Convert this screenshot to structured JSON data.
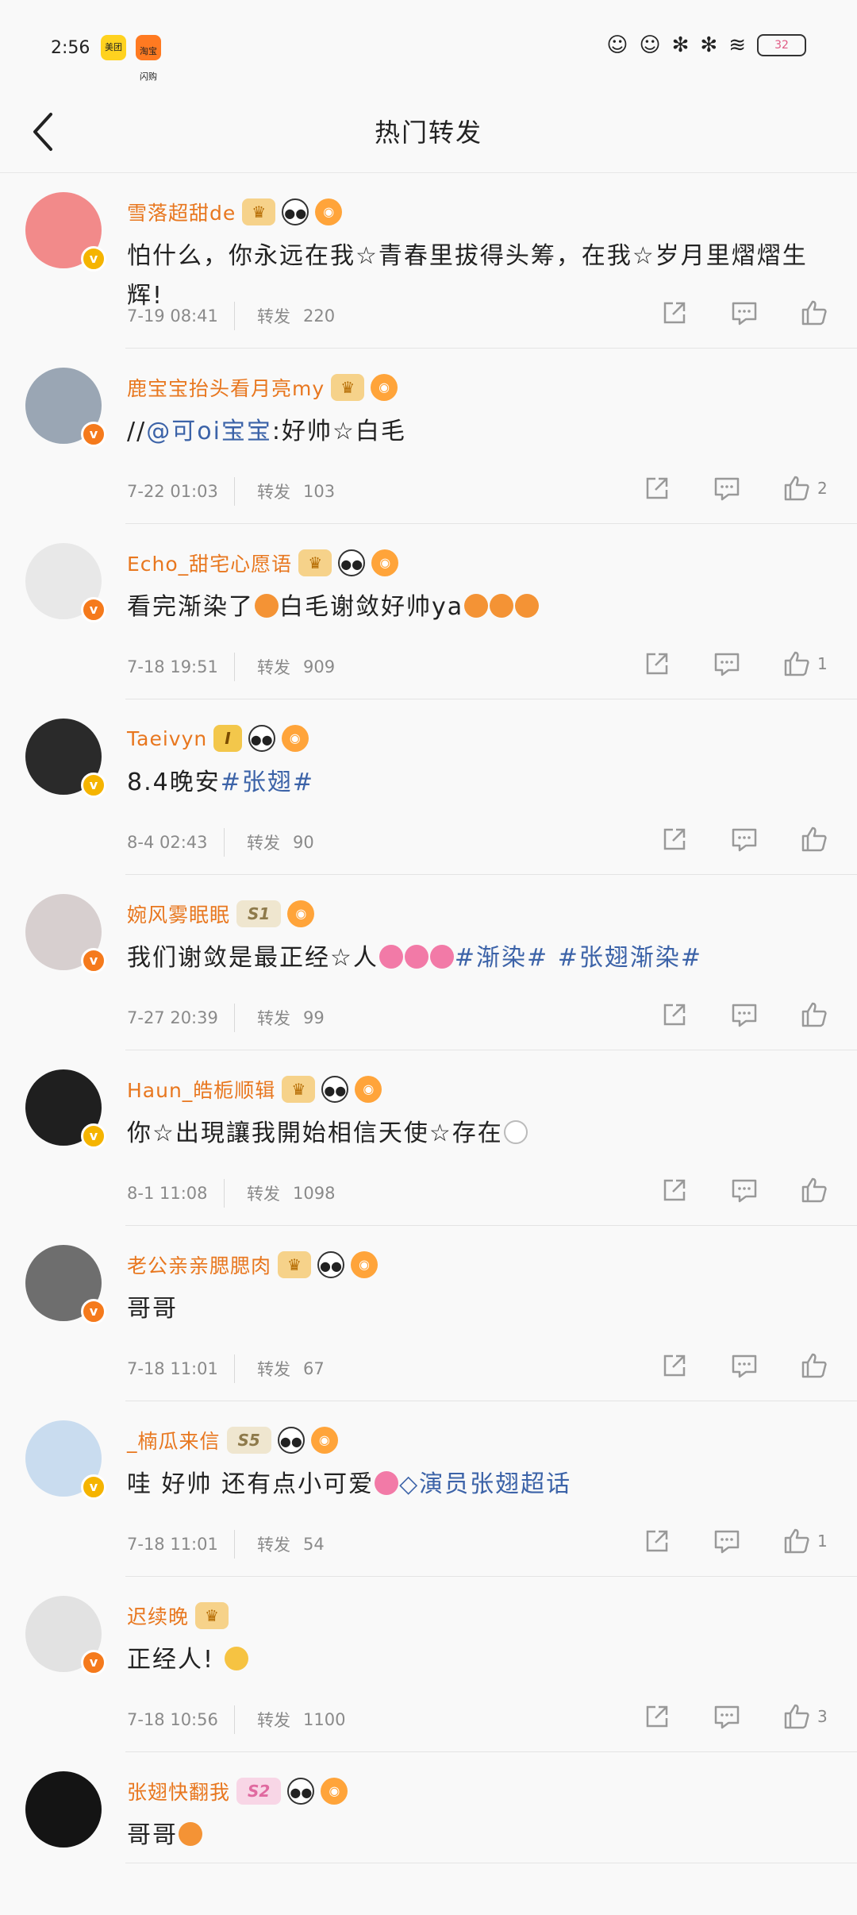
{
  "status_bar": {
    "time": "2:56",
    "battery": "32"
  },
  "header": {
    "title": "热门转发"
  },
  "items": [
    {
      "name": "雪落超甜de",
      "content": "怕什么，你永远在我☆青春里拔得头筹，在我☆岁月里熠熠生辉!",
      "date": "7-19 08:41",
      "repost_label": "转发",
      "repost_count": "220",
      "likes": ""
    },
    {
      "name": "鹿宝宝抬头看月亮my",
      "content_prefix": "//",
      "mention": "@可oi宝宝",
      "content": ":好帅☆白毛",
      "date": "7-22 01:03",
      "repost_label": "转发",
      "repost_count": "103",
      "likes": "2"
    },
    {
      "name": "Echo_甜宅心愿语",
      "content": "看完渐染了",
      "content2": "白毛谢敛好帅ya",
      "date": "7-18 19:51",
      "repost_label": "转发",
      "repost_count": "909",
      "likes": "1"
    },
    {
      "name": "Taeivyn",
      "level": "I",
      "content": "8.4晚安",
      "topic": "#张翅#",
      "date": "8-4 02:43",
      "repost_label": "转发",
      "repost_count": "90",
      "likes": ""
    },
    {
      "name": "婉风雾眠眠",
      "level": "S1",
      "content": "我们谢敛是最正经☆人",
      "topic": "#渐染# #张翅渐染#",
      "date": "7-27 20:39",
      "repost_label": "转发",
      "repost_count": "99",
      "likes": ""
    },
    {
      "name": "Haun_皓栀顺辑",
      "content": "你☆出現讓我開始相信天使☆存在",
      "date": "8-1 11:08",
      "repost_label": "转发",
      "repost_count": "1098",
      "likes": ""
    },
    {
      "name": "老公亲亲腮腮肉",
      "content": "哥哥",
      "date": "7-18 11:01",
      "repost_label": "转发",
      "repost_count": "67",
      "likes": ""
    },
    {
      "name": "_楠瓜来信",
      "level": "S5",
      "content": "哇 好帅 还有点小可爱",
      "topic": "演员张翅超话",
      "date": "7-18 11:01",
      "repost_label": "转发",
      "repost_count": "54",
      "likes": "1"
    },
    {
      "name": "迟续晚",
      "content": "正经人!",
      "date": "7-18 10:56",
      "repost_label": "转发",
      "repost_count": "1100",
      "likes": "3"
    },
    {
      "name": "张翅快翻我",
      "level": "S2",
      "content": "哥哥",
      "date": "",
      "repost_label": "",
      "repost_count": "",
      "likes": ""
    }
  ]
}
